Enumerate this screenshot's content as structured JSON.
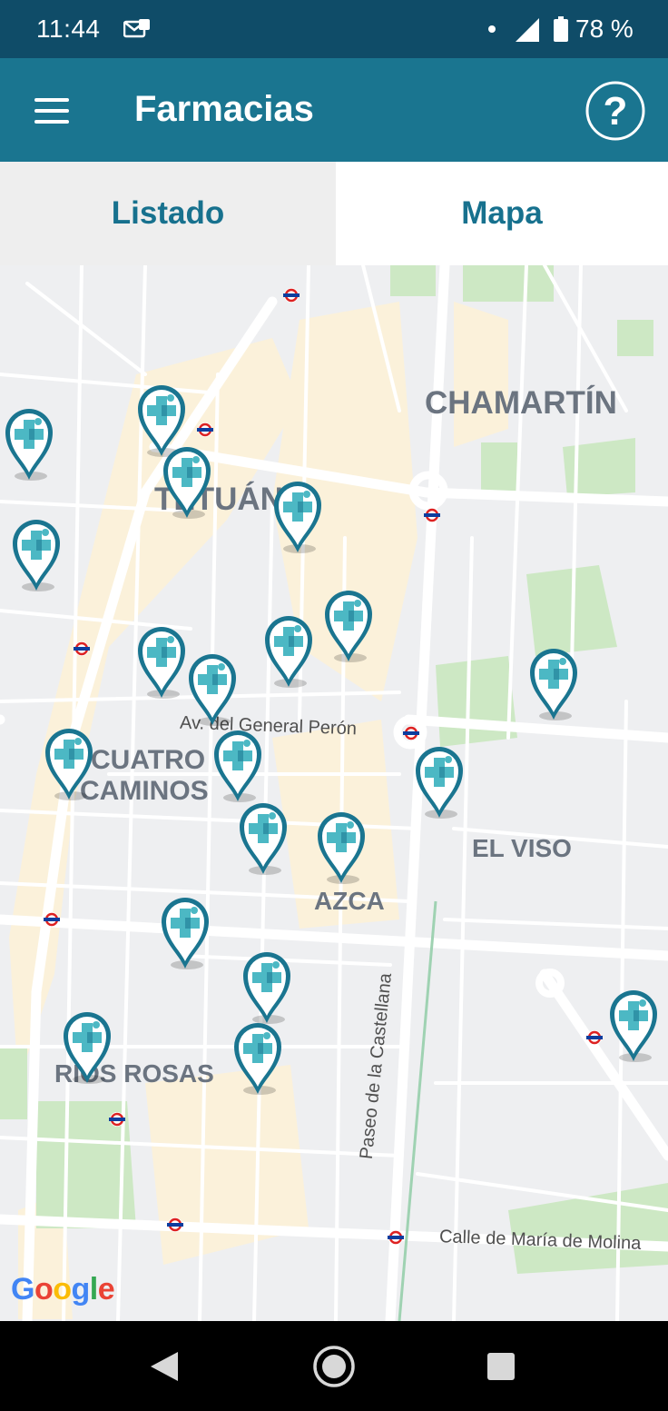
{
  "status_bar": {
    "time": "11:44",
    "battery_percent": "78 %"
  },
  "app_bar": {
    "title": "Farmacias",
    "menu_icon": "hamburger-menu-icon",
    "help_icon": "help-circle-icon"
  },
  "tabs": [
    {
      "label": "Listado",
      "selected": false
    },
    {
      "label": "Mapa",
      "selected": true
    }
  ],
  "map": {
    "districts": {
      "chamartin": "CHAMARTÍN",
      "tetuan": "TETUÁN",
      "cuatro_caminos_1": "CUATRO",
      "cuatro_caminos_2": "CAMINOS",
      "el_viso": "EL VISO",
      "azca": "AZCA",
      "rios_rosas": "RIOS ROSAS"
    },
    "streets": {
      "general_peron": "Av. del General Perón",
      "castellana": "Paseo de la Castellana",
      "maria_de_molina": "Calle de María de Molina"
    },
    "pharmacy_marker_icon": "pharmacy-cross-pin-icon",
    "pharmacy_marker_count": 21,
    "attribution": "Google"
  },
  "nav_bar": {
    "back": "back-icon",
    "home": "home-icon",
    "recents": "recents-icon"
  },
  "colors": {
    "status_bar": "#0f4c68",
    "app_bar": "#1a7590",
    "accent": "#17718e",
    "marker": "#1a7590",
    "marker_cross": "#4cb8c4"
  }
}
